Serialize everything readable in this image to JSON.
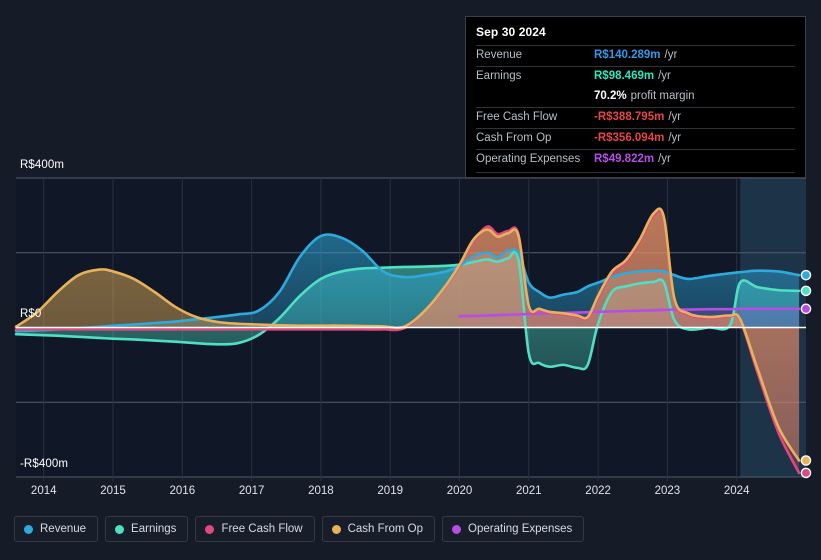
{
  "background": "#151c28",
  "tooltip": {
    "title": "Sep 30 2024",
    "rows": [
      {
        "label": "Revenue",
        "value": "R$140.289m",
        "unit": "/yr",
        "color": "#3399e6"
      },
      {
        "label": "Earnings",
        "value": "R$98.469m",
        "unit": "/yr",
        "color": "#2ee6c0"
      },
      {
        "label": "",
        "value": "70.2%",
        "unit": "profit margin",
        "color": "#ffffff"
      },
      {
        "label": "Free Cash Flow",
        "value": "-R$388.795m",
        "unit": "/yr",
        "color": "#e64545"
      },
      {
        "label": "Cash From Op",
        "value": "-R$356.094m",
        "unit": "/yr",
        "color": "#e64545"
      },
      {
        "label": "Operating Expenses",
        "value": "R$49.822m",
        "unit": "/yr",
        "color": "#b84de6"
      }
    ]
  },
  "legend": {
    "items": [
      {
        "label": "Revenue",
        "color": "#2eaadc"
      },
      {
        "label": "Earnings",
        "color": "#4fe0c4"
      },
      {
        "label": "Free Cash Flow",
        "color": "#e0487f"
      },
      {
        "label": "Cash From Op",
        "color": "#e8b25a"
      },
      {
        "label": "Operating Expenses",
        "color": "#b84de6"
      }
    ]
  },
  "chart_data": {
    "type": "area",
    "title": "",
    "xlabel": "",
    "ylabel": "",
    "currency": "R$",
    "units": "millions",
    "grid": true,
    "legend_position": "bottom",
    "ylim": [
      -400,
      400
    ],
    "ytick_labels": [
      "R$400m",
      "R$0",
      "-R$400m"
    ],
    "ytick_values": [
      400,
      0,
      -400
    ],
    "gridline_values": [
      400,
      200,
      0,
      -200,
      -400
    ],
    "xlim": [
      2013.6,
      2025.0
    ],
    "xtick_labels": [
      "2014",
      "2015",
      "2016",
      "2017",
      "2018",
      "2019",
      "2020",
      "2021",
      "2022",
      "2023",
      "2024"
    ],
    "xtick_values": [
      2014,
      2015,
      2016,
      2017,
      2018,
      2019,
      2020,
      2021,
      2022,
      2023,
      2024
    ],
    "forecast_region": {
      "start": 2024.05,
      "end": 2025.0,
      "shaded": true
    },
    "x": [
      2013.6,
      2013.9,
      2014.2,
      2014.5,
      2014.8,
      2015.0,
      2015.3,
      2015.6,
      2015.9,
      2016.2,
      2016.5,
      2016.8,
      2017.1,
      2017.4,
      2017.7,
      2018.0,
      2018.3,
      2018.6,
      2018.9,
      2019.2,
      2019.5,
      2019.8,
      2020.0,
      2020.2,
      2020.4,
      2020.55,
      2020.7,
      2020.85,
      2021.0,
      2021.15,
      2021.3,
      2021.5,
      2021.7,
      2021.85,
      2022.0,
      2022.2,
      2022.4,
      2022.6,
      2022.8,
      2022.95,
      2023.1,
      2023.3,
      2023.6,
      2023.9,
      2024.05,
      2024.3,
      2024.6,
      2024.9
    ],
    "series": [
      {
        "name": "Revenue",
        "color": "#2eaadc",
        "values": [
          -10,
          -8,
          -5,
          -2,
          2,
          5,
          8,
          12,
          16,
          22,
          28,
          35,
          45,
          95,
          190,
          245,
          240,
          205,
          150,
          135,
          140,
          150,
          165,
          190,
          200,
          188,
          205,
          200,
          120,
          95,
          80,
          88,
          95,
          110,
          120,
          135,
          145,
          150,
          152,
          150,
          140,
          130,
          138,
          145,
          148,
          152,
          150,
          140
        ]
      },
      {
        "name": "Earnings",
        "color": "#4fe0c4",
        "values": [
          -18,
          -20,
          -22,
          -25,
          -28,
          -30,
          -32,
          -35,
          -38,
          -42,
          -45,
          -42,
          -20,
          25,
          85,
          130,
          150,
          158,
          160,
          162,
          163,
          165,
          168,
          175,
          182,
          176,
          185,
          183,
          -70,
          -95,
          -105,
          -100,
          -108,
          -100,
          10,
          95,
          110,
          118,
          122,
          120,
          20,
          -5,
          0,
          5,
          120,
          108,
          100,
          98
        ]
      },
      {
        "name": "Free Cash Flow",
        "color": "#e0487f",
        "values": [
          -5,
          -5,
          -5,
          -5,
          -5,
          -5,
          -5,
          -5,
          -5,
          -5,
          -5,
          -5,
          -5,
          -5,
          -5,
          -5,
          -5,
          -5,
          -5,
          -2,
          45,
          110,
          165,
          230,
          270,
          250,
          258,
          250,
          55,
          48,
          40,
          35,
          30,
          25,
          80,
          145,
          175,
          230,
          300,
          290,
          75,
          35,
          25,
          30,
          20,
          -120,
          -280,
          -389
        ]
      },
      {
        "name": "Cash From Op",
        "color": "#e8b25a",
        "values": [
          2,
          40,
          95,
          140,
          155,
          150,
          130,
          95,
          55,
          28,
          15,
          10,
          8,
          6,
          5,
          5,
          5,
          4,
          3,
          2,
          45,
          112,
          168,
          235,
          262,
          243,
          252,
          246,
          58,
          50,
          42,
          38,
          32,
          28,
          85,
          150,
          180,
          235,
          305,
          295,
          78,
          38,
          28,
          32,
          22,
          -110,
          -265,
          -356
        ]
      },
      {
        "name": "Operating Expenses",
        "color": "#b84de6",
        "values": [
          null,
          null,
          null,
          null,
          null,
          null,
          null,
          null,
          null,
          null,
          null,
          null,
          null,
          null,
          null,
          null,
          null,
          null,
          null,
          null,
          null,
          null,
          30,
          31,
          32,
          33,
          34,
          35,
          36,
          37,
          38,
          39,
          40,
          41,
          42,
          43,
          44,
          45,
          46,
          47,
          48,
          48,
          49,
          49,
          50,
          50,
          50,
          50
        ]
      }
    ]
  }
}
